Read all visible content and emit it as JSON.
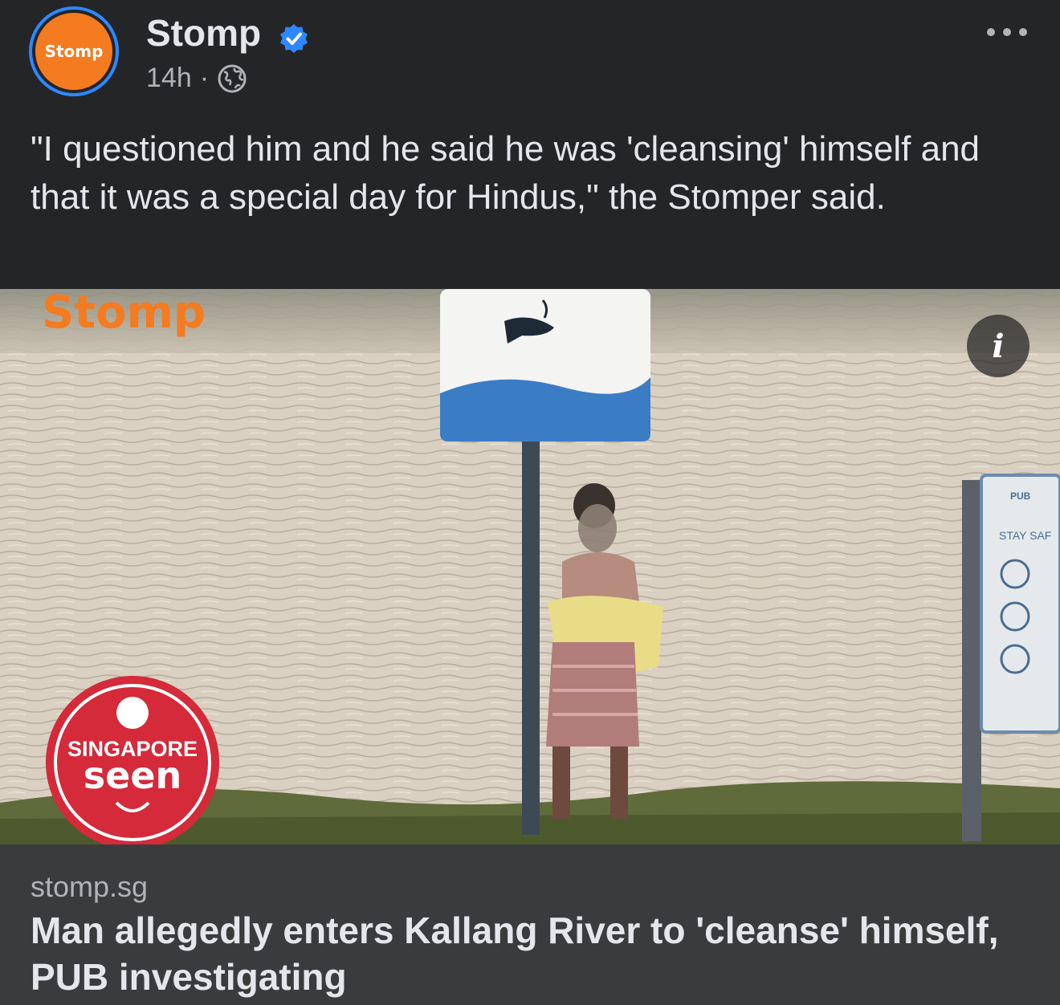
{
  "post": {
    "page_name": "Stomp",
    "avatar_label": "Stomp",
    "time": "14h",
    "separator": "·",
    "caption": "\"I questioned him and he said he was 'cleansing' himself and that it was a special day for Hindus,\" the Stomper said."
  },
  "image": {
    "watermark": "Stomp",
    "badge_top": "SINGAPORE",
    "badge_bottom": "seen",
    "sign_text": "STAY SAF",
    "sign_brand": "PUB",
    "info_icon": "i"
  },
  "link": {
    "domain": "stomp.sg",
    "headline": "Man allegedly enters Kallang River to 'cleanse' himself, PUB investigating"
  },
  "colors": {
    "background": "#242526",
    "link_box": "#3a3b3c",
    "accent_orange": "#f47b20",
    "verified_blue": "#2d88ff",
    "badge_red": "#d42a3a"
  },
  "icons": [
    "verified-badge-icon",
    "globe-icon",
    "more-options-icon",
    "info-icon"
  ]
}
